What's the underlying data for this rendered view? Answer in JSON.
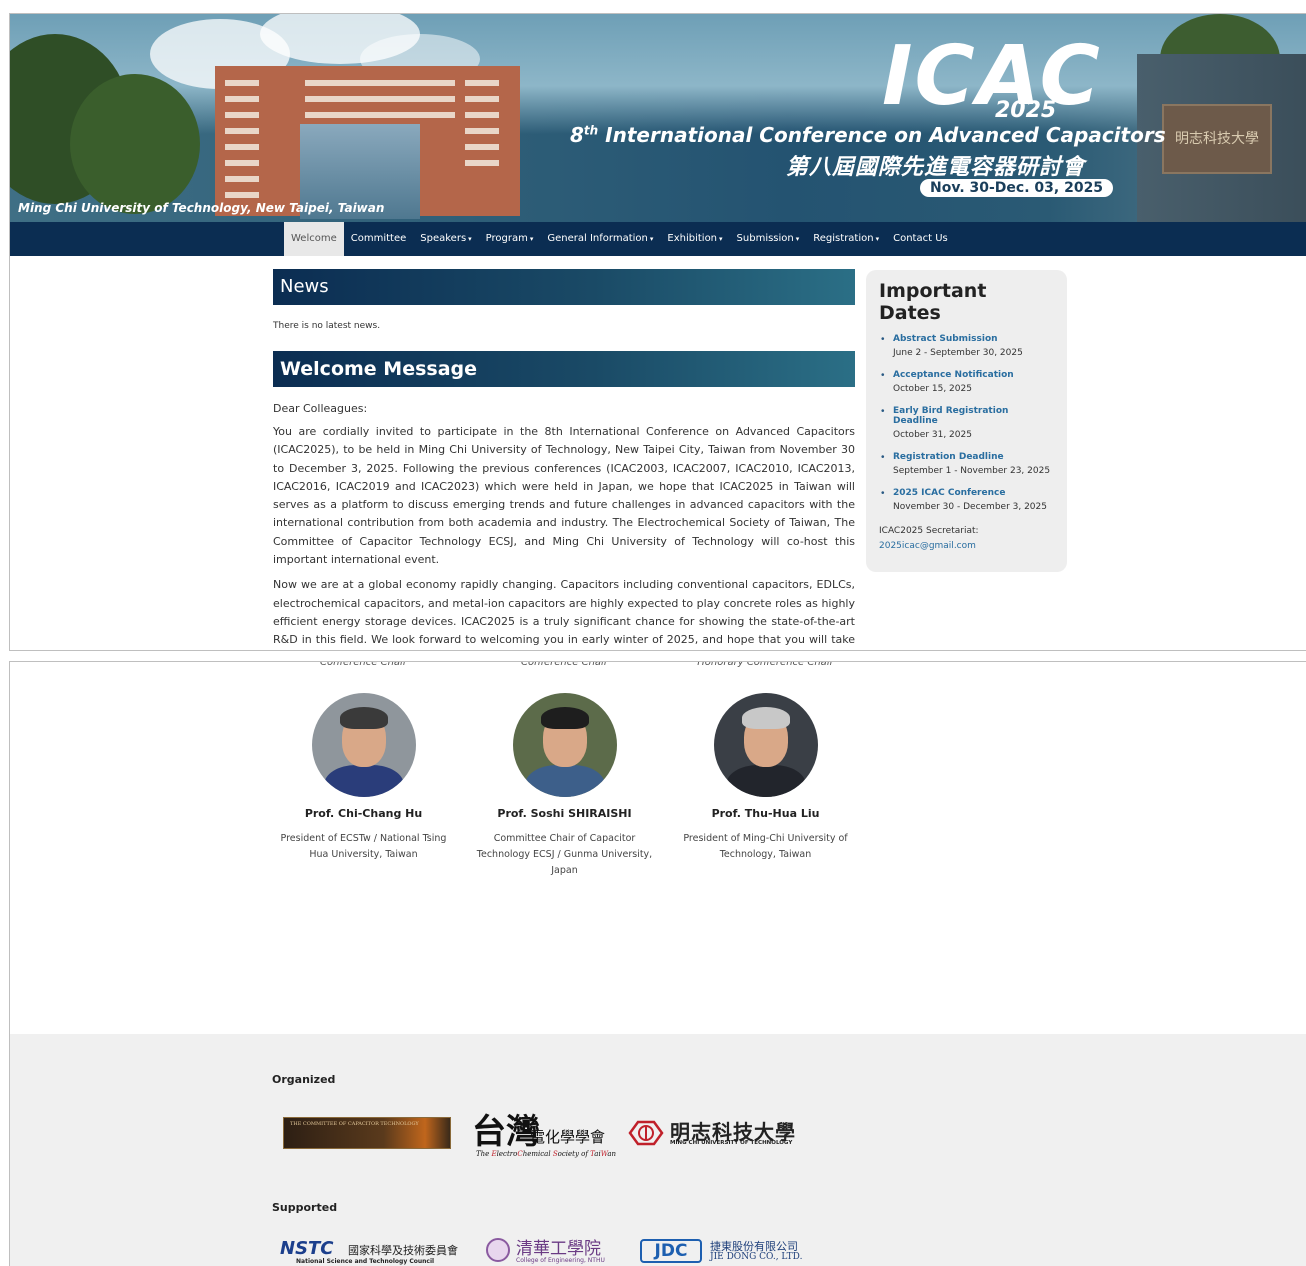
{
  "banner": {
    "logo_text": "ICAC",
    "logo_year": "2025",
    "title_ordinal": "8",
    "title_ordinal_sup": "th",
    "title": " International Conference on Advanced Capacitors",
    "title_cn": "第八屆國際先進電容器研討會",
    "dates": "Nov. 30-Dec. 03, 2025",
    "venue": "Ming Chi University of Technology, New Taipei, Taiwan",
    "plaque_text": "明志科技大學"
  },
  "nav": {
    "items": [
      {
        "label": "Welcome",
        "dropdown": false,
        "active": true
      },
      {
        "label": "Committee",
        "dropdown": false
      },
      {
        "label": "Speakers",
        "dropdown": true
      },
      {
        "label": "Program",
        "dropdown": true
      },
      {
        "label": "General Information",
        "dropdown": true
      },
      {
        "label": "Exhibition",
        "dropdown": true
      },
      {
        "label": "Submission",
        "dropdown": true
      },
      {
        "label": "Registration",
        "dropdown": true
      },
      {
        "label": "Contact Us",
        "dropdown": false
      }
    ],
    "caret": "▾"
  },
  "news": {
    "heading": "News",
    "empty_text": "There is no latest news."
  },
  "welcome": {
    "heading": "Welcome Message",
    "salutation": "Dear Colleagues:",
    "paragraph1": "You are cordially invited to participate in the 8th International Conference on Advanced Capacitors (ICAC2025), to be held in Ming Chi University of Technology, New Taipei City, Taiwan from November 30 to December 3, 2025. Following the previous conferences (ICAC2003, ICAC2007, ICAC2010, ICAC2013, ICAC2016, ICAC2019 and ICAC2023) which were held in Japan, we hope that ICAC2025 in Taiwan will serves as a platform to discuss emerging trends and future challenges in advanced capacitors with the international contribution from both academia and industry. The Electrochemical Society of Taiwan, The Committee of Capacitor Technology ECSJ, and Ming Chi University of Technology will co-host this important international event.",
    "paragraph2": "Now we are at a global economy rapidly changing. Capacitors including conventional capacitors, EDLCs, electrochemical capacitors, and metal-ion capacitors are highly expected to play concrete roles as highly efficient energy storage devices. ICAC2025 is a truly significant chance for showing the state-of-the-art R&D in this field. We look forward to welcoming you in early winter of 2025, and hope that you will take this opportunity to experience New Taipei City."
  },
  "important_dates": {
    "heading": "Important Dates",
    "bullet": "•",
    "items": [
      {
        "label": "Abstract Submission",
        "value": "June 2 - September 30, 2025"
      },
      {
        "label": "Acceptance Notification",
        "value": "October 15, 2025"
      },
      {
        "label": "Early Bird Registration Deadline",
        "value": "October 31, 2025"
      },
      {
        "label": "Registration Deadline",
        "value": "September 1 - November 23, 2025"
      },
      {
        "label": "2025 ICAC Conference",
        "value": "November 30 - December 3, 2025"
      }
    ],
    "secretariat_label": "ICAC2025 Secretariat:",
    "secretariat_email": "2025icac@gmail.com"
  },
  "chairs": [
    {
      "role": "Conference Chair",
      "name": "Prof. Chi-Chang Hu",
      "affiliation": "President of ECSTw / National Tsing Hua University, Taiwan",
      "photo": {
        "bg": "#8f969c",
        "hair": "#3a3a3a",
        "body": "#2a3d7a"
      }
    },
    {
      "role": "Conference Chair",
      "name": "Prof. Soshi SHIRAISHI",
      "affiliation": "Committee Chair of Capacitor Technology ECSJ / Gunma University, Japan",
      "photo": {
        "bg": "#5c6b4a",
        "hair": "#1e1e1e",
        "body": "#3d5f8a"
      }
    },
    {
      "role": "Honorary Conference Chair",
      "name": "Prof. Thu-Hua Liu",
      "affiliation": "President of Ming-Chi University of Technology, Taiwan",
      "photo": {
        "bg": "#3a3f46",
        "hair": "#c8c8c8",
        "body": "#22252c"
      }
    }
  ],
  "footer": {
    "organized_label": "Organized",
    "supported_label": "Supported",
    "organizers": {
      "cct": "THE COMMITTEE OF CAPACITOR TECHNOLOGY",
      "ecs_big": "台灣",
      "ecs_cn": "電化學學會",
      "ecs_en_pre": "The ",
      "ecs_en_e": "E",
      "ecs_en_mid1": "lectro",
      "ecs_en_c": "C",
      "ecs_en_mid2": "hemical ",
      "ecs_en_s": "S",
      "ecs_en_mid3": "ociety of ",
      "ecs_en_t": "T",
      "ecs_en_ai": "ai",
      "ecs_en_w": "W",
      "ecs_en_an": "an",
      "mcut_cn": "明志科技大學",
      "mcut_en": "MING CHI UNIVERSITY OF TECHNOLOGY"
    },
    "supporters": {
      "nstc_mark": "NSTC",
      "nstc_cn": "國家科學及技術委員會",
      "nstc_en": "National Science and Technology Council",
      "nthu_cn": "清華工學院",
      "nthu_en": "College of Engineering, NTHU",
      "jdc_mark": "JDC",
      "jdc_cn": "捷東股份有限公司",
      "jdc_en": "JIE DONG CO., LTD."
    }
  }
}
